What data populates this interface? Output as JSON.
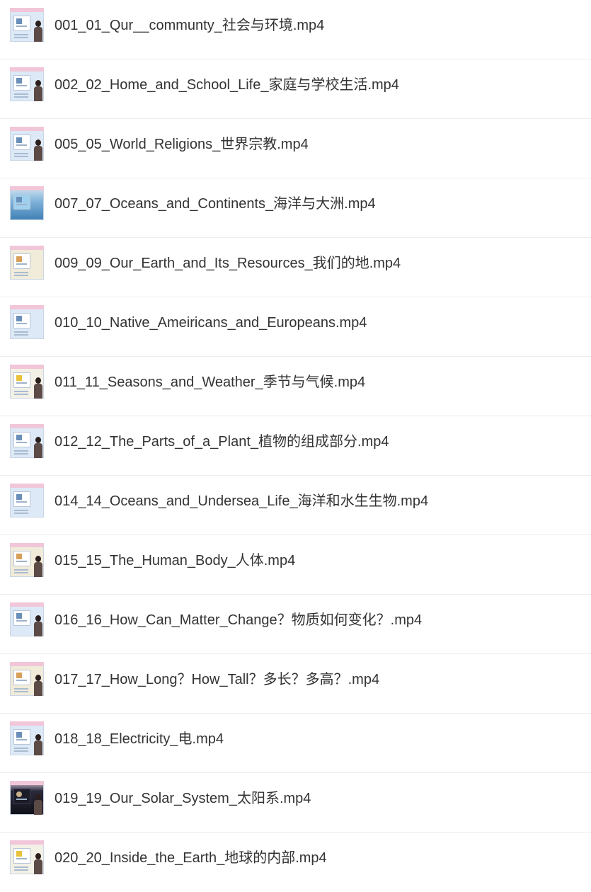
{
  "files": [
    {
      "name": "001_01_Qur__communty_社会与环境.mp4",
      "thumb": "slide-presenter-thumbnail-icon"
    },
    {
      "name": "002_02_Home_and_School_Life_家庭与学校生活.mp4",
      "thumb": "slide-presenter-thumbnail-icon"
    },
    {
      "name": "005_05_World_Religions_世界宗教.mp4",
      "thumb": "slide-presenter-thumbnail-icon"
    },
    {
      "name": "007_07_Oceans_and_Continents_海洋与大洲.mp4",
      "thumb": "ocean-map-thumbnail-icon"
    },
    {
      "name": "009_09_Our_Earth_and_Its_Resources_我们的地.mp4",
      "thumb": "slide-thumbnail-icon"
    },
    {
      "name": "010_10_Native_Ameiricans_and_Europeans.mp4",
      "thumb": "slide-thumbnail-icon"
    },
    {
      "name": "011_11_Seasons_and_Weather_季节与气候.mp4",
      "thumb": "slide-presenter-thumbnail-icon"
    },
    {
      "name": "012_12_The_Parts_of_a_Plant_植物的组成部分.mp4",
      "thumb": "slide-presenter-thumbnail-icon"
    },
    {
      "name": "014_14_Oceans_and_Undersea_Life_海洋和水生生物.mp4",
      "thumb": "slide-thumbnail-icon"
    },
    {
      "name": "015_15_The_Human_Body_人体.mp4",
      "thumb": "slide-presenter-thumbnail-icon"
    },
    {
      "name": "016_16_How_Can_Matter_Change？物质如何变化？.mp4",
      "thumb": "presenter-thumbnail-icon"
    },
    {
      "name": "017_17_How_Long？How_Tall？多长？多高？.mp4",
      "thumb": "slide-presenter-thumbnail-icon"
    },
    {
      "name": "018_18_Electricity_电.mp4",
      "thumb": "slide-presenter-thumbnail-icon"
    },
    {
      "name": "019_19_Our_Solar_System_太阳系.mp4",
      "thumb": "solar-system-thumbnail-icon"
    },
    {
      "name": "020_20_Inside_the_Earth_地球的内部.mp4",
      "thumb": "earth-layers-thumbnail-icon"
    }
  ]
}
